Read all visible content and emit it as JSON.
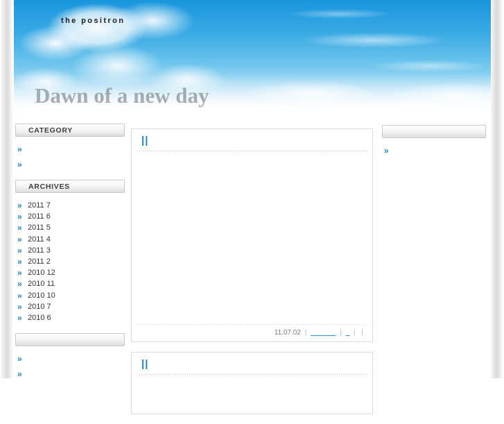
{
  "banner": {
    "site_name": "the positron",
    "title": "Dawn of a new day"
  },
  "colors": {
    "link_blue": "#1a86d0",
    "meta_link": "#3d96d6",
    "sky_top": "#1995dd",
    "heading_text": "#3d3d3d",
    "banner_title": "rgba(120,125,130,0.62)"
  },
  "sidebar_left": {
    "widgets": [
      {
        "heading": "CATEGORY",
        "items": [
          {
            "arrow": "»",
            "label": ""
          },
          {
            "arrow": "»",
            "label": ""
          }
        ]
      },
      {
        "heading": "ARCHIVES",
        "items": [
          {
            "arrow": "»",
            "label": "2011 7"
          },
          {
            "arrow": "»",
            "label": "2011 6"
          },
          {
            "arrow": "»",
            "label": "2011 5"
          },
          {
            "arrow": "»",
            "label": "2011 4"
          },
          {
            "arrow": "»",
            "label": "2011 3"
          },
          {
            "arrow": "»",
            "label": "2011 2"
          },
          {
            "arrow": "»",
            "label": "2010 12"
          },
          {
            "arrow": "»",
            "label": "2010 11"
          },
          {
            "arrow": "»",
            "label": "2010 10"
          },
          {
            "arrow": "»",
            "label": "2010 7"
          },
          {
            "arrow": "»",
            "label": "2010 6"
          }
        ]
      },
      {
        "heading": "",
        "items": [
          {
            "arrow": "»",
            "label": ""
          },
          {
            "arrow": "»",
            "label": ""
          }
        ]
      }
    ]
  },
  "sidebar_right": {
    "widgets": [
      {
        "heading": "",
        "items": [
          {
            "arrow": "»",
            "label": ""
          }
        ]
      }
    ]
  },
  "main": {
    "posts": [
      {
        "title": "||",
        "body": "",
        "meta": {
          "date": "11.07.02",
          "sep": "|",
          "link_1": "______",
          "link_2": "_",
          "tail": "|"
        }
      },
      {
        "title": "||",
        "body": "",
        "meta": {
          "date": "",
          "sep": "",
          "link_1": "",
          "link_2": "",
          "tail": ""
        }
      }
    ]
  }
}
